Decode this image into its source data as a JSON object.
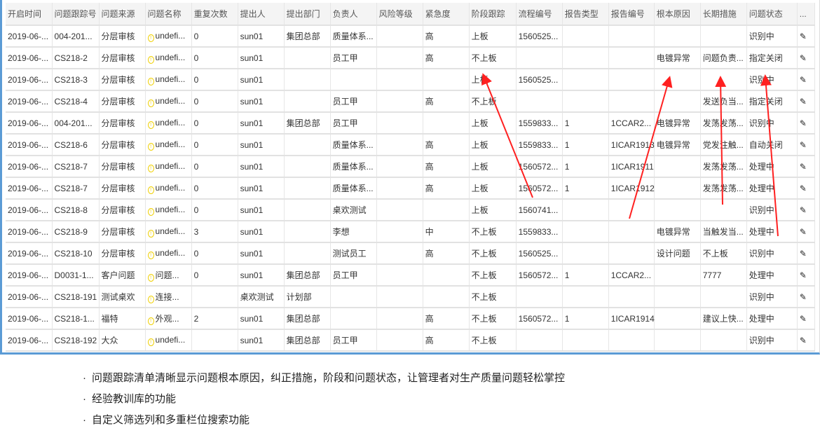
{
  "table": {
    "columns": [
      "开启时间",
      "问题跟踪号",
      "问题来源",
      "问题名称",
      "重复次数",
      "提出人",
      "提出部门",
      "负责人",
      "风险等级",
      "紧急度",
      "阶段跟踪",
      "流程编号",
      "报告类型",
      "报告编号",
      "根本原因",
      "长期措施",
      "问题状态",
      "..."
    ],
    "rows": [
      [
        "2019-06-...",
        "004-201...",
        "分层审核",
        "undefi...",
        "0",
        "sun01",
        "集团总部",
        "质量体系...",
        "",
        "高",
        "上板",
        "1560525...",
        "",
        "",
        "",
        "",
        "识别中"
      ],
      [
        "2019-06-...",
        "CS218-2",
        "分层审核",
        "undefi...",
        "0",
        "sun01",
        "",
        "员工甲",
        "",
        "高",
        "不上板",
        "",
        "",
        "",
        "电镀异常",
        "问题负责...",
        "指定关闭"
      ],
      [
        "2019-06-...",
        "CS218-3",
        "分层审核",
        "undefi...",
        "0",
        "sun01",
        "",
        "",
        "",
        "",
        "上板",
        "1560525...",
        "",
        "",
        "",
        "",
        "识别中"
      ],
      [
        "2019-06-...",
        "CS218-4",
        "分层审核",
        "undefi...",
        "0",
        "sun01",
        "",
        "员工甲",
        "",
        "高",
        "不上板",
        "",
        "",
        "",
        "",
        "发送负当...",
        "指定关闭"
      ],
      [
        "2019-06-...",
        "004-201...",
        "分层审核",
        "undefi...",
        "0",
        "sun01",
        "集团总部",
        "员工甲",
        "",
        "",
        "上板",
        "1559833...",
        "1",
        "1CCAR2...",
        "电镀异常",
        "发荡发荡...",
        "识别中"
      ],
      [
        "2019-06-...",
        "CS218-6",
        "分层审核",
        "undefi...",
        "0",
        "sun01",
        "",
        "质量体系...",
        "",
        "高",
        "上板",
        "1559833...",
        "1",
        "1ICAR1913",
        "电镀异常",
        "党发注触...",
        "自动关闭"
      ],
      [
        "2019-06-...",
        "CS218-7",
        "分层审核",
        "undefi...",
        "0",
        "sun01",
        "",
        "质量体系...",
        "",
        "高",
        "上板",
        "1560572...",
        "1",
        "1ICAR1911",
        "",
        "发荡发荡...",
        "处理中"
      ],
      [
        "2019-06-...",
        "CS218-7",
        "分层审核",
        "undefi...",
        "0",
        "sun01",
        "",
        "质量体系...",
        "",
        "高",
        "上板",
        "1560572...",
        "1",
        "1ICAR1912",
        "",
        "发荡发荡...",
        "处理中"
      ],
      [
        "2019-06-...",
        "CS218-8",
        "分层审核",
        "undefi...",
        "0",
        "sun01",
        "",
        "桌欢测试",
        "",
        "",
        "上板",
        "1560741...",
        "",
        "",
        "",
        "",
        "识别中"
      ],
      [
        "2019-06-...",
        "CS218-9",
        "分层审核",
        "undefi...",
        "3",
        "sun01",
        "",
        "李想",
        "",
        "中",
        "不上板",
        "1559833...",
        "",
        "",
        "电镀异常",
        "当触发当...",
        "处理中"
      ],
      [
        "2019-06-...",
        "CS218-10",
        "分层审核",
        "undefi...",
        "0",
        "sun01",
        "",
        "测试员工",
        "",
        "高",
        "不上板",
        "1560525...",
        "",
        "",
        "设计问题",
        "不上板",
        "识别中"
      ],
      [
        "2019-06-...",
        "D0031-1...",
        "客户问题",
        "问题...",
        "0",
        "sun01",
        "集团总部",
        "员工甲",
        "",
        "",
        "不上板",
        "1560572...",
        "1",
        "1CCAR2...",
        "",
        "7777",
        "处理中"
      ],
      [
        "2019-06-...",
        "CS218-191",
        "测试桌欢",
        "连接...",
        "",
        "桌欢测试",
        "计划部",
        "",
        "",
        "",
        "不上板",
        "",
        "",
        "",
        "",
        "",
        "识别中"
      ],
      [
        "2019-06-...",
        "CS218-1...",
        "福特",
        "外观...",
        "2",
        "sun01",
        "集团总部",
        "",
        "",
        "高",
        "不上板",
        "1560572...",
        "1",
        "1ICAR1914",
        "",
        "建议上快...",
        "处理中"
      ],
      [
        "2019-06-...",
        "CS218-192",
        "大众",
        "undefi...",
        "",
        "sun01",
        "集团总部",
        "员工甲",
        "",
        "高",
        "不上板",
        "",
        "",
        "",
        "",
        "",
        "识别中"
      ]
    ],
    "row_action_icon": "pencil-edit-icon",
    "name_icon": "warning-circle-icon"
  },
  "notes": [
    "问题跟踪清单清晰显示问题根本原因，纠正措施，阶段和问题状态，让管理者对生产质量问题轻松掌控",
    "经验教训库的功能",
    "自定义筛选列和多重栏位搜索功能"
  ],
  "bullet": "·",
  "colors": {
    "frame": "#5b9bd5",
    "arrow": "#ff2020",
    "warning": "#f0d000"
  }
}
